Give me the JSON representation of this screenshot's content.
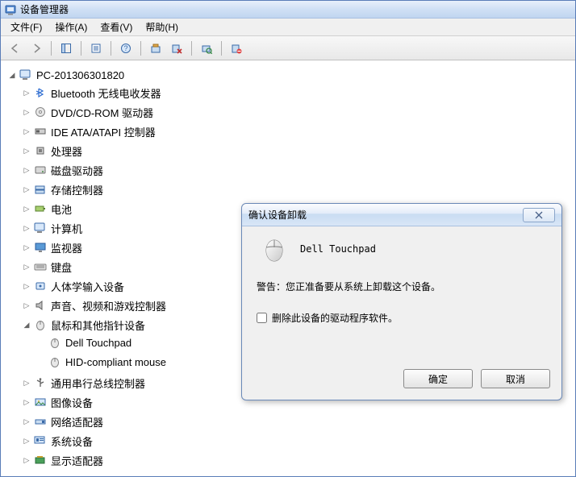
{
  "window": {
    "title": "设备管理器"
  },
  "menu": {
    "file": "文件(F)",
    "action": "操作(A)",
    "view": "查看(V)",
    "help": "帮助(H)"
  },
  "tree": {
    "root": "PC-201306301820",
    "items": [
      "Bluetooth 无线电收发器",
      "DVD/CD-ROM 驱动器",
      "IDE ATA/ATAPI 控制器",
      "处理器",
      "磁盘驱动器",
      "存储控制器",
      "电池",
      "计算机",
      "监视器",
      "键盘",
      "人体学输入设备",
      "声音、视频和游戏控制器",
      "鼠标和其他指针设备",
      "通用串行总线控制器",
      "图像设备",
      "网络适配器",
      "系统设备",
      "显示适配器"
    ],
    "mouse_children": [
      "Dell Touchpad",
      "HID-compliant mouse"
    ]
  },
  "dialog": {
    "title": "确认设备卸载",
    "device": "Dell Touchpad",
    "warning": "警告：您正准备要从系统上卸载这个设备。",
    "checkbox": "删除此设备的驱动程序软件。",
    "ok": "确定",
    "cancel": "取消"
  }
}
